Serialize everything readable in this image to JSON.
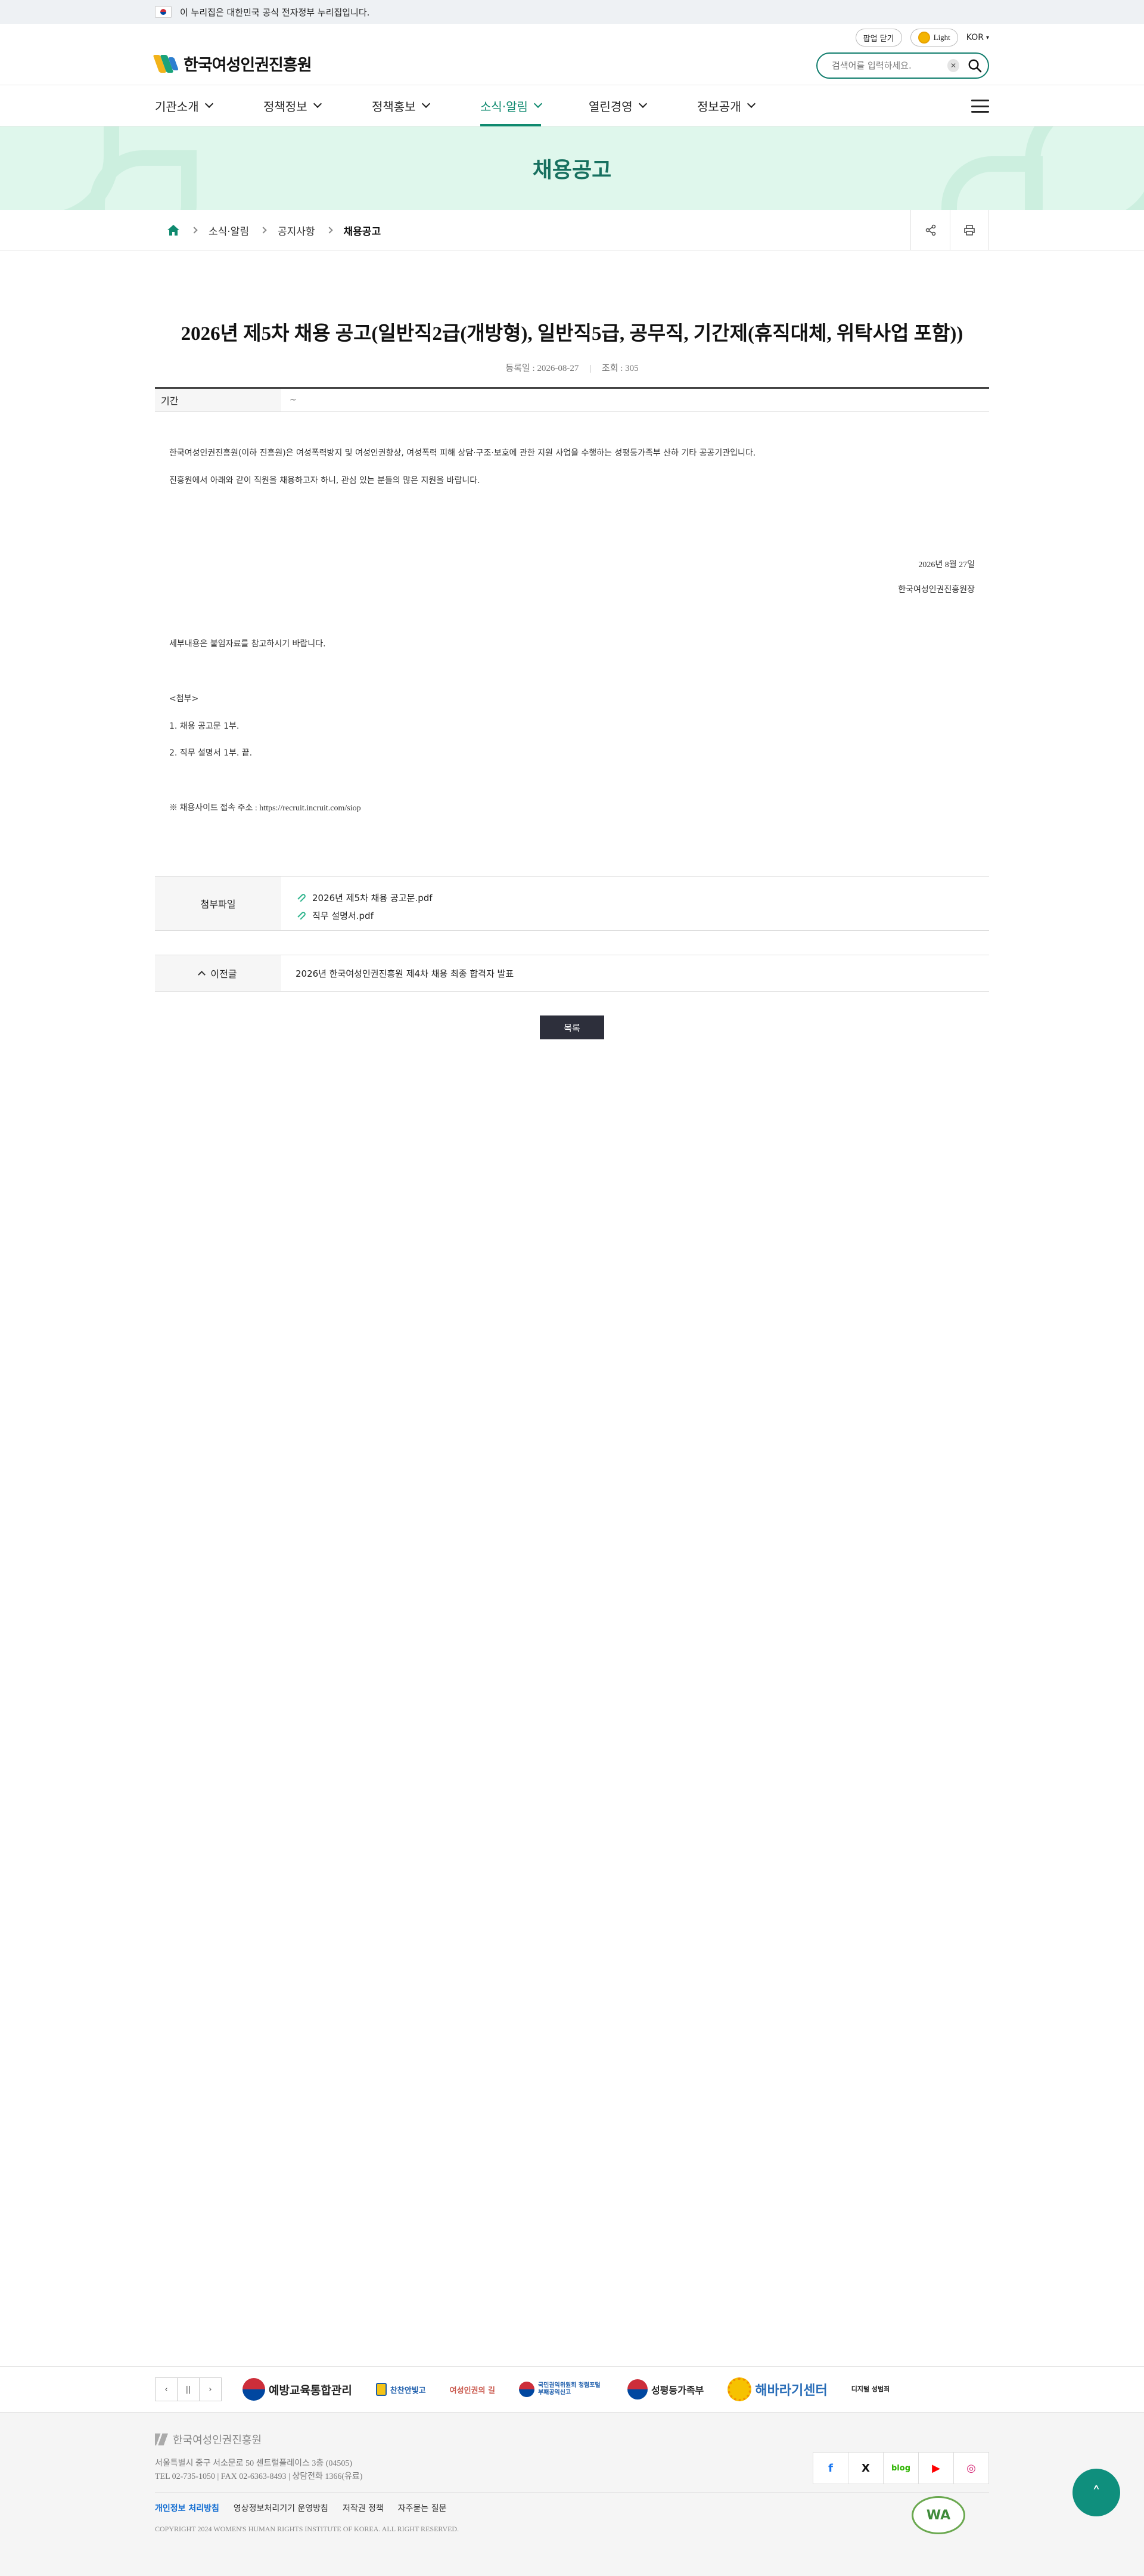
{
  "gov_banner": {
    "text": "이 누리집은 대한민국 공식 전자정부 누리집입니다."
  },
  "header": {
    "popup_close": "팝업 닫기",
    "theme": "Light",
    "language": "KOR",
    "logo_text": "한국여성인권진흥원",
    "search_placeholder": "검색어를 입력하세요."
  },
  "nav": {
    "items": [
      {
        "label": "기관소개"
      },
      {
        "label": "정책정보"
      },
      {
        "label": "정책홍보"
      },
      {
        "label": "소식·알림"
      },
      {
        "label": "열린경영"
      },
      {
        "label": "정보공개"
      }
    ],
    "active_index": 3
  },
  "hero": {
    "title": "채용공고"
  },
  "breadcrumb": {
    "items": [
      "소식·알림",
      "공지사항",
      "채용공고"
    ]
  },
  "article": {
    "title": "2026년 제5차 채용 공고(일반직2급(개방형), 일반직5급, 공무직, 기간제(휴직대체, 위탁사업 포함))",
    "date_label": "등록일 : 2026-08-27",
    "views_label": "조회 : 305",
    "period_label": "기간",
    "period_value": "~",
    "body": [
      "한국여성인권진흥원(이하 진흥원)은 여성폭력방지 및 여성인권향상, 여성폭력 피해 상담·구조·보호에 관한 지원 사업을 수행하는 성평등가족부 산하 기타 공공기관입니다.",
      "진흥원에서 아래와 같이 직원을 채용하고자 하니, 관심 있는 분들의 많은 지원을 바랍니다."
    ],
    "sign_date": "2026년 8월 27일",
    "sign_org": "한국여성인권진흥원장",
    "extra": [
      "세부내용은 붙임자료를 참고하시기 바랍니다.",
      "<첨부>",
      "1. 채용 공고문 1부.",
      "2. 직무 설명서 1부.  끝.",
      "※ 채용사이트 접속 주소 : https://recruit.incruit.com/siop"
    ]
  },
  "attachments": {
    "label": "첨부파일",
    "files": [
      "2026년 제5차 채용 공고문.pdf",
      "직무 설명서.pdf"
    ]
  },
  "prev": {
    "label": "이전글",
    "title": "2026년 한국여성인권진흥원 제4차 채용 최종 합격자 발표"
  },
  "list_button": "목록",
  "banners": {
    "pause": "||",
    "logos": [
      "예방교육통합관리",
      "찬찬안빛고",
      "여성인권의 길",
      "국민권익위원회 청렴포털 부패공익신고",
      "성평등가족부",
      "해바라기센터",
      "디지털 성범죄"
    ]
  },
  "footer": {
    "logo_text": "한국여성인권진흥원",
    "address": "서울특별시 중구 서소문로 50 센트럴플레이스 3층 (04505)",
    "contact": "TEL 02-735-1050 | FAX 02-6363-8493 | 상담전화 1366(유료)",
    "links": [
      "개인정보 처리방침",
      "영상정보처리기기 운영방침",
      "저작권 정책",
      "자주묻는 질문"
    ],
    "copyright": "COPYRIGHT 2024 WOMEN'S HUMAN RIGHTS INSTITUTE OF KOREA. ALL RIGHT RESERVED.",
    "sns": [
      "f",
      "X",
      "blog",
      "▶",
      "◎"
    ],
    "wa": "WA"
  },
  "colors": {
    "accent": "#0f8a6f",
    "hero_bg": "#dff7ec",
    "button_dark": "#2d2f3b"
  }
}
